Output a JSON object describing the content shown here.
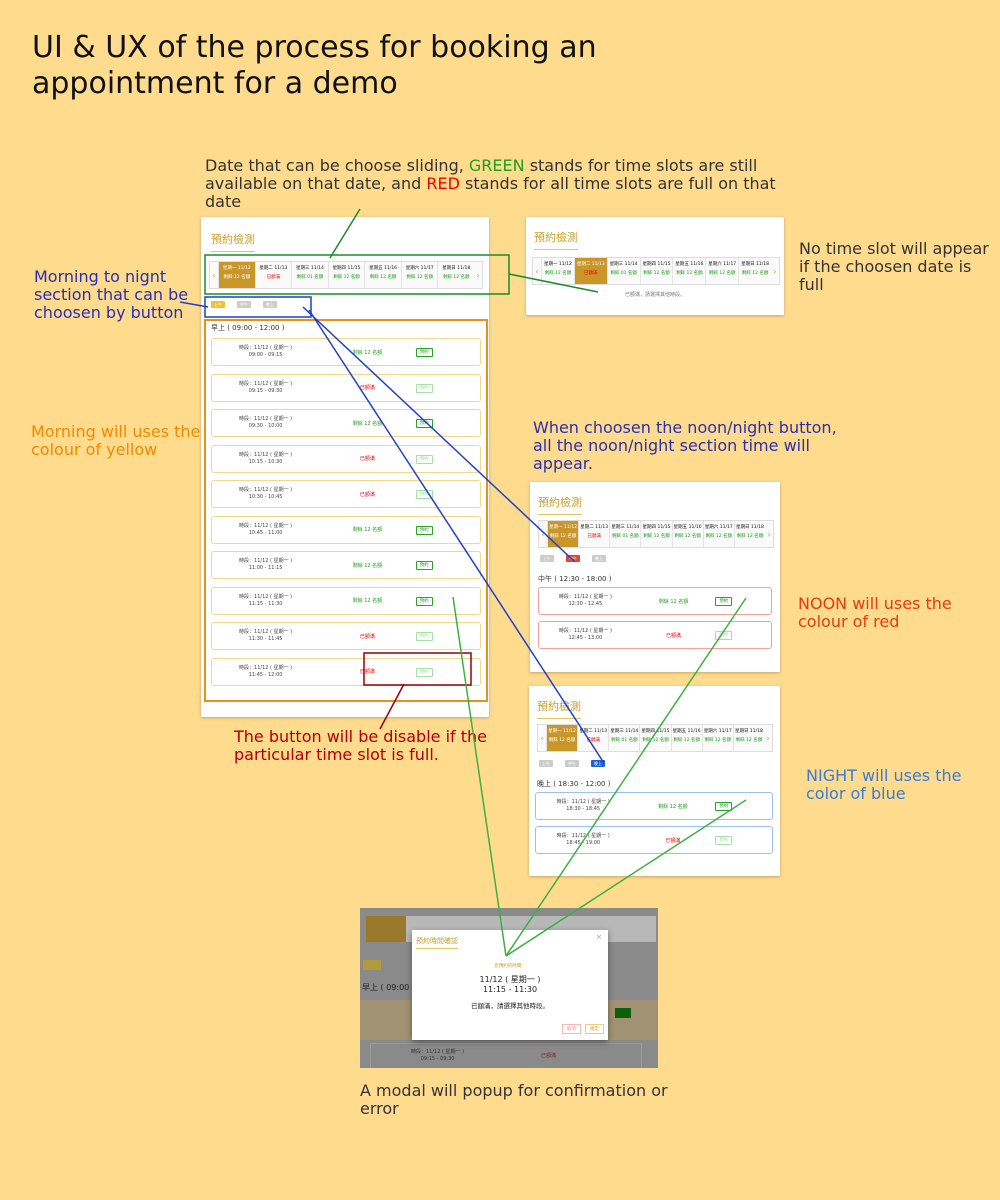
{
  "title": "UI & UX of the process for booking an appointment for a demo",
  "notes": {
    "date_pre": "Date that can be choose sliding, ",
    "date_green": "GREEN",
    "date_mid": " stands for time slots are still available on that date, and ",
    "date_red": "RED",
    "date_post": " stands for all time slots are full on that date",
    "section_btn": "Morning to nignt section that can be choosen by button",
    "morning": "Morning will uses the colour of yellow",
    "no_slot": "No time slot will appear if the choosen date is full",
    "noon_click": "When choosen the noon/night button, all the noon/night section time will appear.",
    "noon_color": "NOON will uses the colour of red",
    "night_color": "NIGHT will uses the color of blue",
    "disable": "The button will be disable if the particular time slot is full.",
    "modal": "A modal will popup for confirmation or error"
  },
  "panel_title": "預約檢測",
  "dates": [
    {
      "label": "星期一 11/12",
      "status": "剩餘 12 名額",
      "state": "sel"
    },
    {
      "label": "星期二 11/13",
      "status": "已額滿",
      "state": "full"
    },
    {
      "label": "星期三 11/14",
      "status": "剩餘 01 名額",
      "state": "ok"
    },
    {
      "label": "星期四 11/15",
      "status": "剩餘 12 名額",
      "state": "ok"
    },
    {
      "label": "星期五 11/16",
      "status": "剩餘 12 名額",
      "state": "ok"
    },
    {
      "label": "星期六 11/17",
      "status": "剩餘 12 名額",
      "state": "ok"
    },
    {
      "label": "星期日 11/18",
      "status": "剩餘 12 名額",
      "state": "ok"
    }
  ],
  "sections": {
    "morning": "上午",
    "noon": "中午",
    "night": "晚上"
  },
  "morning_header": "早上 ( 09:00 - 12:00 )",
  "noon_header": "中午 ( 12:30 - 18:00 )",
  "night_header": "晚上 ( 18:30 - 12:00 )",
  "slot_date": "時段：11/12 ( 星期一 )",
  "btn_label": "預約",
  "full_label": "已額滿",
  "remain_label": "剩餘 12 名額",
  "morning_slots": [
    {
      "time": "09:00 - 09:15",
      "full": false
    },
    {
      "time": "09:15 - 09:30",
      "full": true
    },
    {
      "time": "09:30 - 10:00",
      "full": false
    },
    {
      "time": "10:15 - 10:30",
      "full": true
    },
    {
      "time": "10:30 - 10:45",
      "full": true
    },
    {
      "time": "10:45 - 11:00",
      "full": false
    },
    {
      "time": "11:00 - 11:15",
      "full": false
    },
    {
      "time": "11:15 - 11:30",
      "full": false
    },
    {
      "time": "11:30 - 11:45",
      "full": true
    },
    {
      "time": "11:45 - 12:00",
      "full": true
    }
  ],
  "noon_slots": [
    {
      "time": "12:30 - 12:45",
      "full": false
    },
    {
      "time": "12:45 - 13:00",
      "full": true
    }
  ],
  "night_slots": [
    {
      "time": "18:30 - 18:45",
      "full": false
    },
    {
      "time": "18:45 - 19:00",
      "full": true
    }
  ],
  "full_date_msg": "已額滿，請選擇其他時段。",
  "modal": {
    "title": "預約時間確認",
    "sub": "您預約的時間：",
    "date": "11/12 ( 星期一 )",
    "time": "11:15 - 11:30",
    "msg": "已額滿，請選擇其他時段。",
    "cancel": "取消",
    "confirm": "確定",
    "bg_row_time": "時段：11/12 ( 星期一 )",
    "bg_row_time2": "09:15 - 09:30"
  },
  "colors": {
    "bg": "#FFDB8E",
    "green_link": "#3cb043",
    "blue_link": "#0000ee"
  }
}
